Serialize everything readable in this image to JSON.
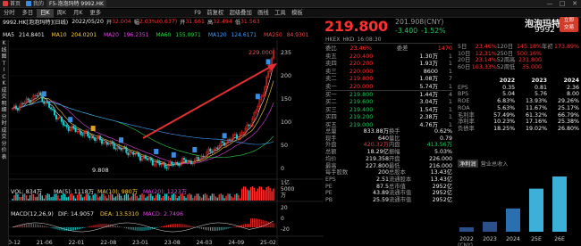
{
  "titlebar": {
    "tabs": [
      {
        "label": "首页",
        "active": false
      },
      {
        "label": "我的",
        "active": false
      },
      {
        "label": "F5-泡泡玛特 9992.HK",
        "active": true
      }
    ],
    "controls": [
      "—",
      "□",
      "✕"
    ]
  },
  "toolbar": {
    "left": [
      "分时",
      "多日",
      "日K",
      "周K",
      "月K",
      "更多"
    ],
    "selected": "日K",
    "right": [
      "F9",
      "前复权",
      "超级叠加",
      "画线",
      "工具",
      "模板"
    ]
  },
  "stock": {
    "code_label": "9992.HK[泡泡玛特]",
    "chart_type": "(日线)",
    "date": "2022/05/20",
    "open_label": "开",
    "open": "32.004",
    "change_label": "幅",
    "change": "2.03%(0.637)",
    "high_label": "开",
    "high": "31.661",
    "low_label": "高",
    "low": "32.494",
    "close_label": "低",
    "close": "31.563"
  },
  "ma": [
    {
      "label": "MA5",
      "value": "214.8401",
      "color": "#e6e6e6"
    },
    {
      "label": "MA10",
      "value": "204.0201",
      "color": "#ffd23a"
    },
    {
      "label": "MA20",
      "value": "196.2351",
      "color": "#e045e0"
    },
    {
      "label": "MA60",
      "value": "155.0971",
      "color": "#2fd24a"
    },
    {
      "label": "MA120",
      "value": "124.6171",
      "color": "#3ca0ff"
    },
    {
      "label": "MA250",
      "value": "84.9301",
      "color": "#ff4040"
    }
  ],
  "sidebar_letters": [
    "K",
    "线",
    "图",
    "",
    "T",
    "I",
    "C",
    "K",
    "",
    "成",
    "交",
    "明",
    "细",
    "",
    "分",
    "时",
    "成",
    "交",
    "",
    "分",
    "价",
    "表"
  ],
  "kline": {
    "price_max_label": "229.000",
    "price_min_label": "9.808",
    "axis_labels": [
      "235",
      "200",
      "150",
      "100",
      "50",
      "0"
    ],
    "x_labels": [
      "20-12",
      "21-06",
      "22-01",
      "22-08",
      "23-01",
      "23-08",
      "24-03",
      "24-09",
      "25-02"
    ]
  },
  "volume": {
    "label": "VOL: 834万",
    "ma5": "MA(5): 1118万",
    "ma10": "MA(10): 980万",
    "ma20": "MA(20): 1223万",
    "axis_labels": [
      "1亿",
      "5000",
      "万"
    ]
  },
  "macd": {
    "label": "MACD(12,26,9)",
    "dif": "DIF: 14.9057",
    "dea": "DEA: 13.5310",
    "macd": "MACD: 2.7496",
    "axis_labels": [
      "20",
      "0",
      "-20"
    ]
  },
  "quote": {
    "price": "219.800",
    "prev": "201.908(CNY)",
    "change": "-3.400",
    "pct": "-1.52%",
    "name": "泡泡玛特",
    "code": "9992",
    "badge": "立即\n交易",
    "market": "HKEX",
    "currency": "HKD",
    "time": "16:08:30"
  },
  "orderbook_header": [
    {
      "label": "委比",
      "value": "23.46%",
      "label2": "委差",
      "value2": "1470"
    }
  ],
  "orderbook": [
    {
      "label": "卖五",
      "price": "220.400",
      "vol": "1.30万",
      "n": "1"
    },
    {
      "label": "卖四",
      "price": "220.200",
      "vol": "1.93万",
      "n": "1"
    },
    {
      "label": "卖三",
      "price": "220.000",
      "vol": "8600",
      "n": "1"
    },
    {
      "label": "卖二",
      "price": "219.800",
      "vol": "1.08万",
      "n": "7"
    },
    {
      "label": "卖一",
      "price": "220.000",
      "vol": "5.74万",
      "n": "1"
    },
    {
      "label": "买一",
      "price": "219.800",
      "vol": "1.44万",
      "n": "4"
    },
    {
      "label": "买二",
      "price": "219.600",
      "vol": "3.04万",
      "n": "1"
    },
    {
      "label": "买三",
      "price": "219.400",
      "vol": "1.54万",
      "n": "1"
    },
    {
      "label": "买四",
      "price": "219.200",
      "vol": "2.38万",
      "n": "1"
    },
    {
      "label": "买五",
      "price": "219.000",
      "vol": "4.76万",
      "n": "1"
    }
  ],
  "stats": [
    {
      "l": "总量",
      "v": "833.88万",
      "l2": "换手",
      "v2": "0.62%"
    },
    {
      "l": "现手",
      "v": "640",
      "l2": "量比",
      "v2": "0.79"
    },
    {
      "l": "外盘",
      "v": "420.32万",
      "l2": "内盘",
      "v2": "413.56万"
    },
    {
      "l": "总额",
      "v": "18.29亿",
      "l2": "振幅",
      "v2": "5.03%"
    },
    {
      "l": "均价",
      "v": "219.358",
      "l2": "开盘",
      "v2": "226.000"
    },
    {
      "l": "最高",
      "v": "227.800",
      "l2": "最低",
      "v2": "216.000"
    },
    {
      "l": "每手股数",
      "v": "200",
      "l2": "总股本",
      "v2": "13.43亿"
    },
    {
      "l": "EPS",
      "v": "2.51",
      "l2": "流通股本",
      "v2": "13.43亿"
    },
    {
      "l": "PE",
      "v": "87.5",
      "l2": "总市值",
      "v2": "2952亿"
    },
    {
      "l": "PE",
      "v": "43.89",
      "l2": "流通市值",
      "v2": "2952亿"
    },
    {
      "l": "PB",
      "v": "25.59",
      "l2": "流通市值",
      "v2": "2952亿"
    }
  ],
  "performance": [
    {
      "l": "5日",
      "v": "23.46%",
      "l2": "120日",
      "v2": "145.18%",
      "l3": "年初",
      "v3": "173.89%"
    },
    {
      "l": "10日",
      "v": "12.31%",
      "l2": "250日",
      "v2": "500.16%"
    },
    {
      "l": "20日",
      "v": "23.14%",
      "l2": "52周高",
      "v2": "231.800"
    },
    {
      "l": "60日",
      "v": "103.33%",
      "l2": "52周低",
      "v2": "35.000"
    }
  ],
  "fin_years": [
    "2022",
    "2023",
    "2024"
  ],
  "financials": [
    {
      "l": "EPS",
      "v": [
        "0.35",
        "0.81",
        "2.36"
      ]
    },
    {
      "l": "BPS",
      "v": [
        "5.04",
        "5.76",
        "8.00"
      ]
    },
    {
      "l": "ROE",
      "v": [
        "6.83%",
        "13.93%",
        "29.26%"
      ]
    },
    {
      "l": "ROA",
      "v": [
        "5.63%",
        "11.67%",
        "25.17%"
      ]
    },
    {
      "l": "毛利率",
      "v": [
        "57.49%",
        "61.32%",
        "66.79%"
      ]
    },
    {
      "l": "净利率",
      "v": [
        "10.23%",
        "17.16%",
        "25.38%"
      ]
    },
    {
      "l": "负债率",
      "v": [
        "18.25%",
        "19.02%",
        "26.80%"
      ]
    }
  ],
  "revenue_panel": {
    "tabs": [
      "净利润",
      "营业总收入"
    ],
    "active": "净利润",
    "currency": "(CNY)",
    "years": [
      "2022",
      "2023",
      "2024",
      "25E",
      "26E"
    ]
  },
  "colors": {
    "up": "#ff3030",
    "down": "#21c55d",
    "accent": "#ffd23a"
  }
}
